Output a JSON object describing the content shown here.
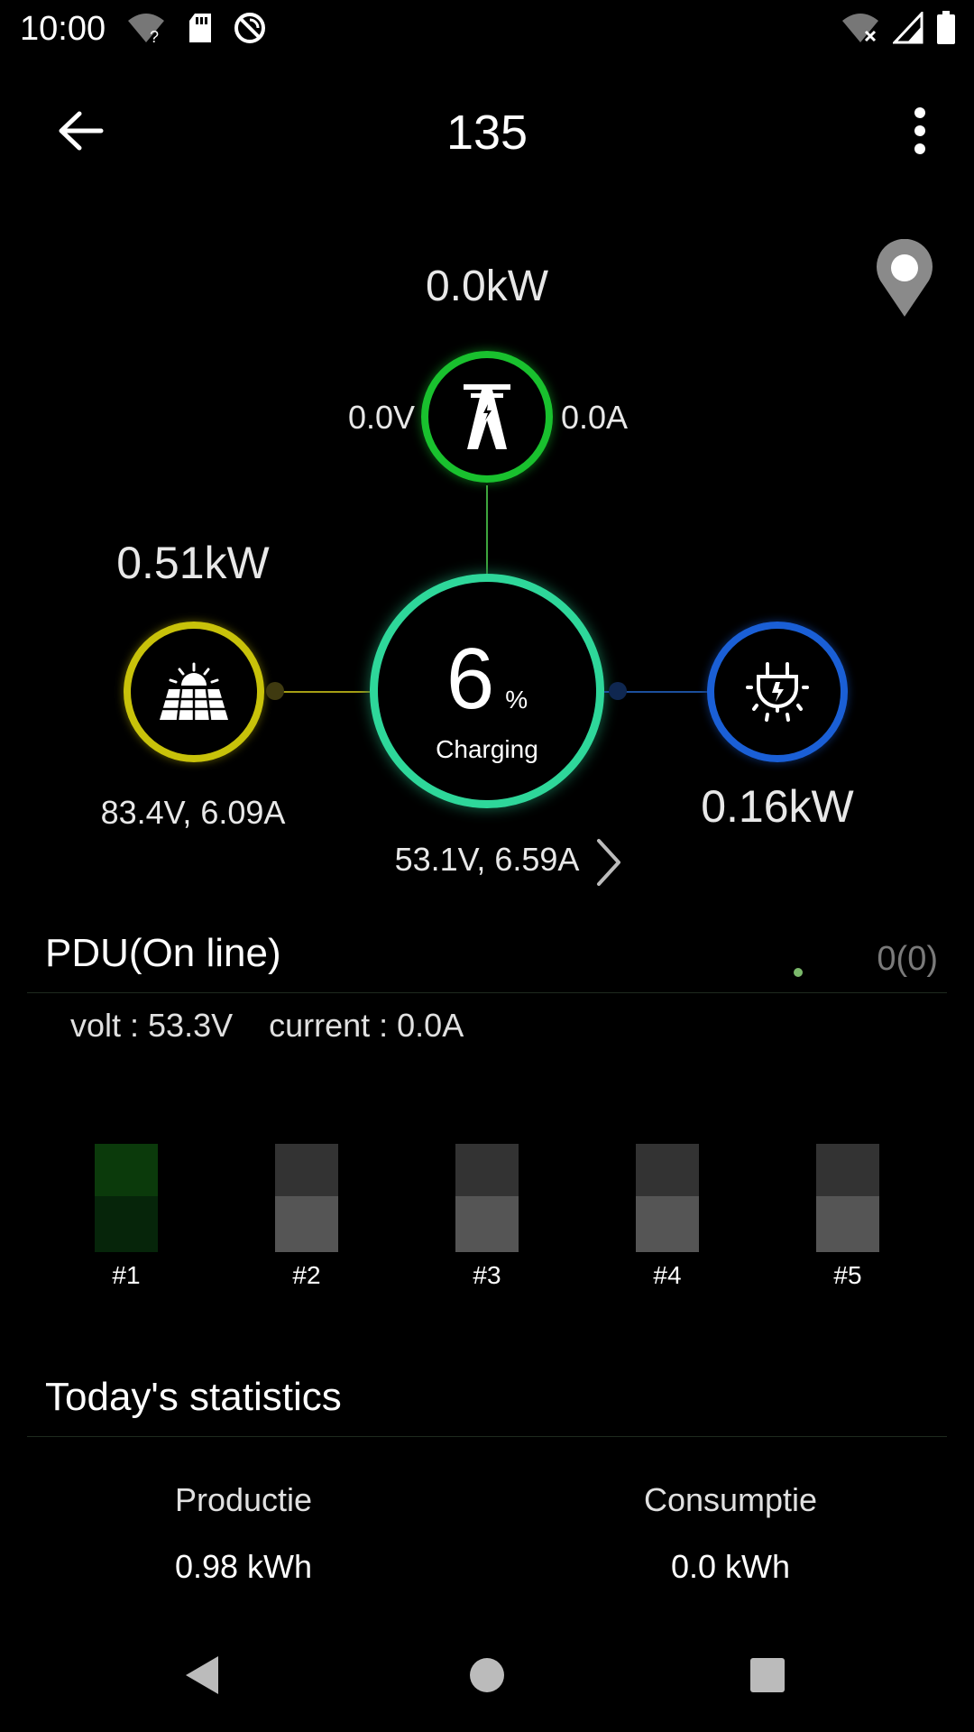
{
  "status_bar": {
    "time": "10:00",
    "icons_left": [
      "wifi-question-icon",
      "sd-card-icon",
      "sync-blocked-icon"
    ],
    "icons_right": [
      "wifi-off-icon",
      "signal-icon",
      "battery-icon"
    ]
  },
  "app_bar": {
    "title": "135",
    "back_icon": "arrow-back-icon",
    "menu_icon": "more-vert-icon"
  },
  "flow": {
    "grid": {
      "power": "0.0kW",
      "voltage": "0.0V",
      "current": "0.0A",
      "icon": "power-tower-icon",
      "color": "#19c12e"
    },
    "solar": {
      "power": "0.51kW",
      "volt_current": "83.4V, 6.09A",
      "icon": "solar-panel-icon",
      "color": "#c8c20a"
    },
    "load": {
      "power": "0.16kW",
      "icon": "light-plug-icon",
      "color": "#1a5fd6"
    },
    "battery": {
      "percent": "6",
      "percent_sign": "%",
      "status": "Charging",
      "volt_current": "53.1V, 6.59A",
      "color": "#2ed79a"
    }
  },
  "pdu": {
    "title": "PDU(On line)",
    "count": "0(0)",
    "info": "volt : 53.3V    current : 0.0A",
    "switches": [
      {
        "label": "#1",
        "state": "on"
      },
      {
        "label": "#2",
        "state": "off"
      },
      {
        "label": "#3",
        "state": "off"
      },
      {
        "label": "#4",
        "state": "off"
      },
      {
        "label": "#5",
        "state": "off"
      }
    ]
  },
  "stats": {
    "title": "Today's statistics",
    "production_label": "Productie",
    "production_value": "0.98 kWh",
    "consumption_label": "Consumptie",
    "consumption_value": "0.0 kWh"
  },
  "nav_bar": {
    "back_icon": "nav-back-icon",
    "home_icon": "nav-home-icon",
    "recents_icon": "nav-recents-icon"
  }
}
